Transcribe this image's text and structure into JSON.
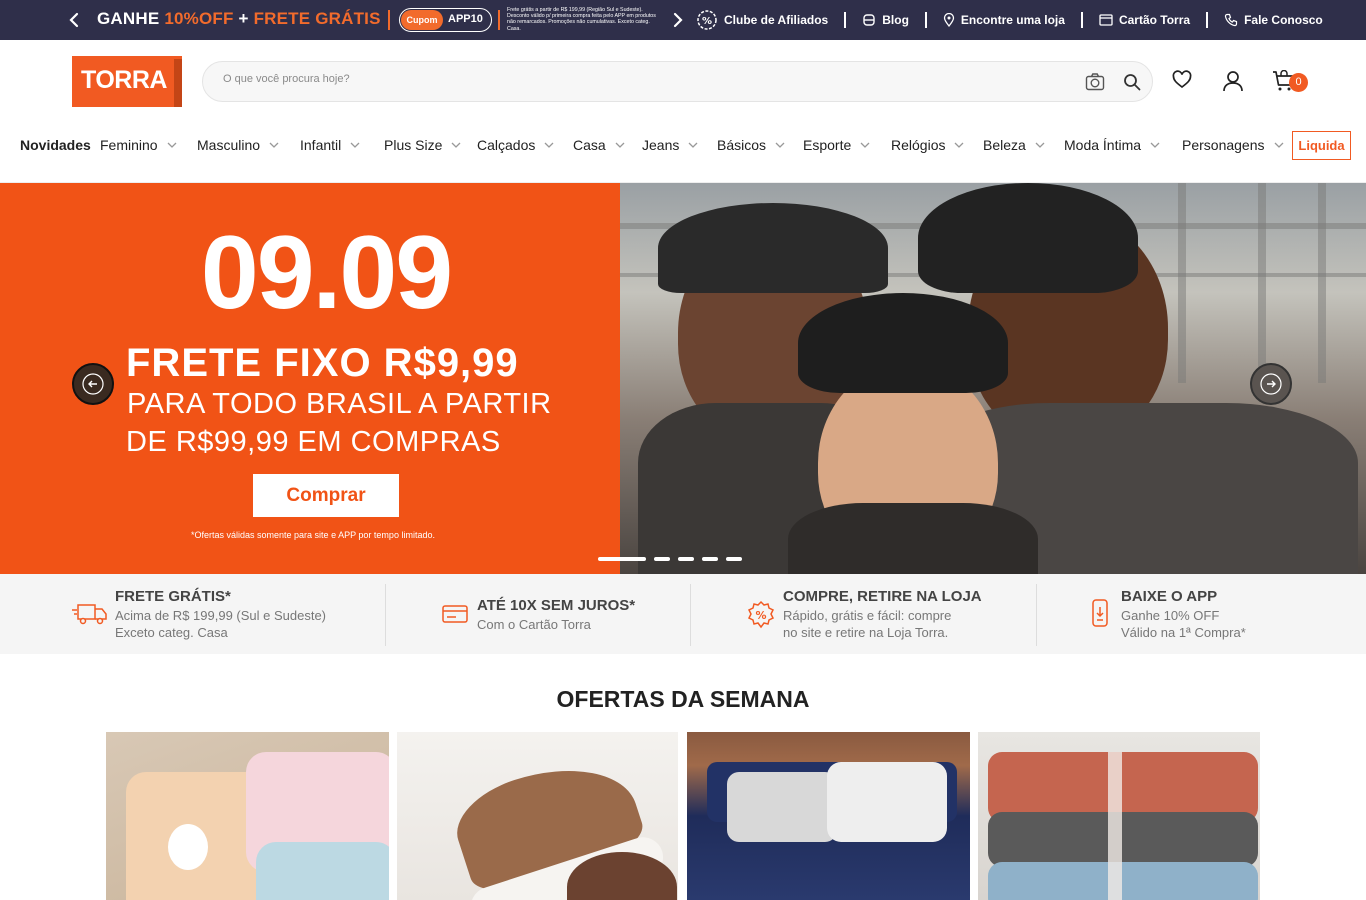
{
  "topbar": {
    "promo_part1": "GANHE",
    "promo_part2": "10%OFF",
    "promo_part3": "+",
    "promo_part4": "FRETE GRÁTIS",
    "coupon_label": "Cupom",
    "coupon_code": "APP10",
    "fineprint": "Frete grátis a partir de R$ 199,99 (Região Sul e Sudeste). Desconto válido p/ primeira compra feita pelo APP em produtos não remarcados. Promoções não cumulativas. Exceto categ. Casa.",
    "links": [
      {
        "label": "Clube de Afiliados",
        "icon": "percent-icon"
      },
      {
        "label": "Blog",
        "icon": "blog-icon"
      },
      {
        "label": "Encontre uma loja",
        "icon": "location-pin-icon"
      },
      {
        "label": "Cartão Torra",
        "icon": "card-icon"
      },
      {
        "label": "Fale Conosco",
        "icon": "phone-icon"
      }
    ]
  },
  "header": {
    "logo_text": "TORRA",
    "search_placeholder": "O que você procura hoje?",
    "cart_count": "0"
  },
  "nav": {
    "items": [
      {
        "label": "Novidades"
      },
      {
        "label": "Feminino"
      },
      {
        "label": "Masculino"
      },
      {
        "label": "Infantil"
      },
      {
        "label": "Plus Size"
      },
      {
        "label": "Calçados"
      },
      {
        "label": "Casa"
      },
      {
        "label": "Jeans"
      },
      {
        "label": "Básicos"
      },
      {
        "label": "Esporte"
      },
      {
        "label": "Relógios"
      },
      {
        "label": "Beleza"
      },
      {
        "label": "Moda Íntima"
      },
      {
        "label": "Personagens"
      }
    ],
    "highlight": "Liquida"
  },
  "hero": {
    "date": "09.09",
    "line1": "FRETE FIXO R$9,99",
    "line2": "PARA TODO BRASIL A PARTIR",
    "line3": "DE R$99,99 EM COMPRAS",
    "button": "Comprar",
    "note": "*Ofertas válidas somente para site e APP por tempo limitado.",
    "slide_count": 5,
    "active_slide": 1
  },
  "benefits": [
    {
      "title": "FRETE GRÁTIS*",
      "line1": "Acima de R$ 199,99 (Sul e Sudeste)",
      "line2": "Exceto categ. Casa",
      "icon": "truck-icon"
    },
    {
      "title": "ATÉ 10X SEM JUROS*",
      "line1": "Com o Cartão Torra",
      "line2": "",
      "icon": "credit-card-icon"
    },
    {
      "title": "COMPRE, RETIRE NA LOJA",
      "line1": "Rápido, grátis e fácil: compre",
      "line2": "no site e retire na Loja Torra.",
      "icon": "discount-badge-icon"
    },
    {
      "title": "BAIXE O APP",
      "line1": "Ganhe 10% OFF",
      "line2": "Válido na 1ª Compra*",
      "icon": "phone-download-icon"
    }
  ],
  "offers": {
    "title": "OFERTAS DA SEMANA"
  },
  "colors": {
    "brand_orange": "#f15a22",
    "topbar_bg": "#2f2f4a"
  }
}
